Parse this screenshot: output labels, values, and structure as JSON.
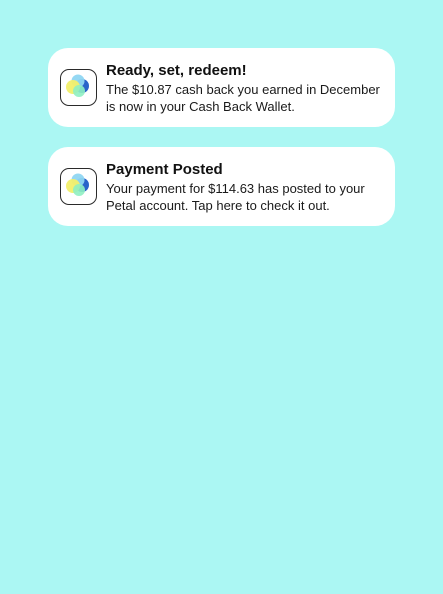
{
  "colors": {
    "background": "#abf7f3",
    "card": "#ffffff",
    "icon_blue": "#2a63c9",
    "icon_yellow": "#f2ef6a",
    "icon_mint": "#8ff0c2",
    "icon_sky": "#8fd6f2"
  },
  "notifications": [
    {
      "app_icon": "petal-app-icon",
      "title": "Ready, set, redeem!",
      "body_lines": [
        "The $10.87 cash back you earned in December",
        "is now in your Cash Back Wallet."
      ]
    },
    {
      "app_icon": "petal-app-icon",
      "title": "Payment Posted",
      "body_lines": [
        "Your payment for $114.63 has posted to your",
        "Petal account. Tap here to check it out."
      ]
    }
  ]
}
